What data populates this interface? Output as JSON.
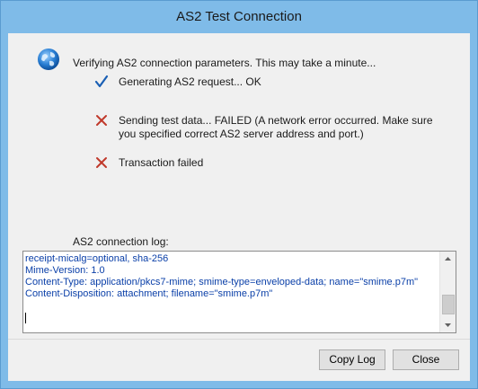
{
  "window": {
    "title": "AS2 Test Connection"
  },
  "header": {
    "message": "Verifying AS2 connection parameters. This may take a minute..."
  },
  "steps": [
    {
      "icon": "checkmark-icon",
      "text": "Generating AS2 request... OK"
    },
    {
      "icon": "error-x-icon",
      "text": "Sending test data... FAILED (A network error occurred. Make sure\nyou specified correct AS2 server address and port.)"
    },
    {
      "icon": "error-x-icon",
      "text": "Transaction failed"
    }
  ],
  "log": {
    "label": "AS2 connection log:",
    "content": "receipt-micalg=optional, sha-256\nMime-Version: 1.0\nContent-Type: application/pkcs7-mime; smime-type=enveloped-data; name=\"smime.p7m\"\nContent-Disposition: attachment; filename=\"smime.p7m\""
  },
  "buttons": {
    "copy_log": "Copy Log",
    "close": "Close"
  },
  "colors": {
    "title_bar": "#7fbbe8",
    "log_text": "#0a3fa8",
    "check": "#1a5fb4",
    "error": "#c0392b"
  }
}
